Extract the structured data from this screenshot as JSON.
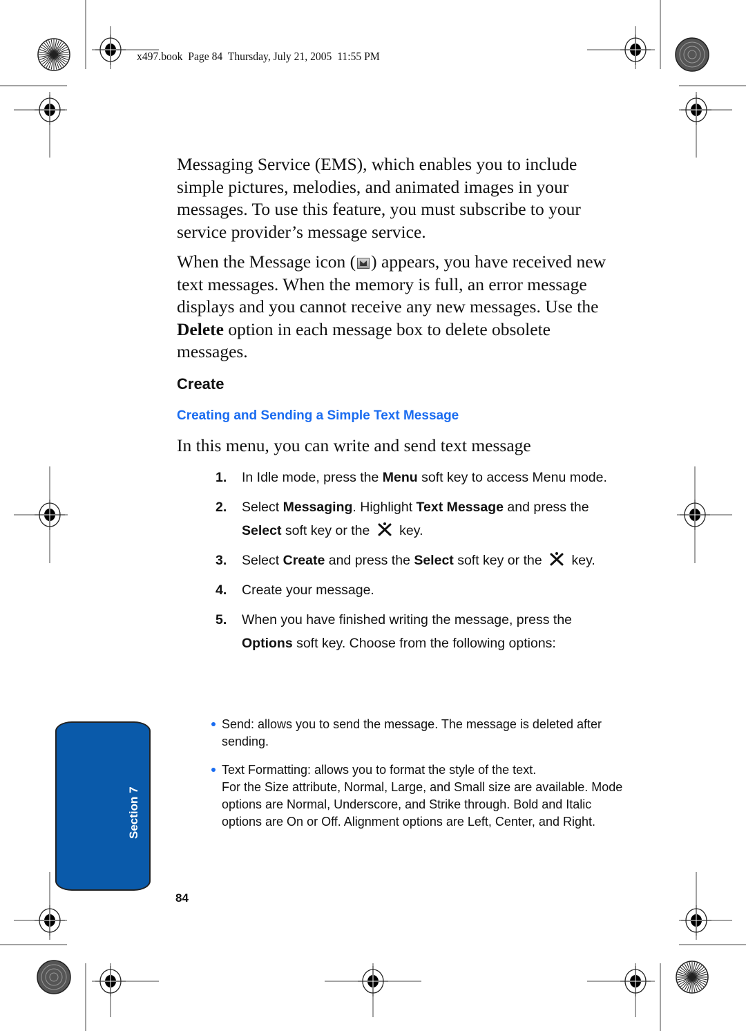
{
  "slug_line": "x497.book  Page 84  Thursday, July 21, 2005  11:55 PM",
  "body": {
    "paragraph_1": "Messaging Service (EMS), which enables you to include simple pictures, melodies, and animated images in your messages. To use this feature, you must subscribe to your service provider’s message service.",
    "paragraph_2": {
      "before_icon": "When the Message icon (",
      "icon": "message-envelope-icon",
      "after_icon": ") appears, you have received new text messages. When the memory is full, an error message displays and you cannot receive any new messages. Use the ",
      "bold": "Delete",
      "end": " option in each message box to delete obsolete messages."
    }
  },
  "section_heading": "Create",
  "subheading": "Creating and Sending a Simple Text Message",
  "intro": "In this menu, you can write and send text message",
  "steps": [
    {
      "num": "1.",
      "parts": [
        "In Idle mode, press the ",
        "Menu",
        " soft key to access Menu mode."
      ]
    },
    {
      "num": "2.",
      "parts": [
        "Select ",
        "Messaging",
        ". Highlight ",
        "Text Message",
        " and press the ",
        "Select",
        " soft key or the ",
        "",
        " key."
      ]
    },
    {
      "num": "3.",
      "parts": [
        "Select ",
        "Create",
        " and press the ",
        "Select",
        " soft key or the ",
        "",
        " key."
      ]
    },
    {
      "num": "4.",
      "parts": [
        "Create your message."
      ]
    },
    {
      "num": "5.",
      "parts": [
        "When you have finished writing the message, press the ",
        "Options",
        " soft key. Choose from the following options:"
      ]
    }
  ],
  "options": [
    {
      "text": "Send: allows you to send the message. The message is deleted after sending."
    },
    {
      "text": "Text Formatting: allows you to format the style of the text.",
      "detail": "For the Size attribute, Normal, Large, and Small size are available. Mode options are Normal, Underscore, and Strike through. Bold and Italic options are On or Off. Alignment options are Left, Center, and Right."
    }
  ],
  "section_tab": {
    "label": "Section 7",
    "color": "#0a5aaa"
  },
  "page_number": "84",
  "colors": {
    "heading_blue": "#1a6cf0",
    "text": "#111111"
  }
}
